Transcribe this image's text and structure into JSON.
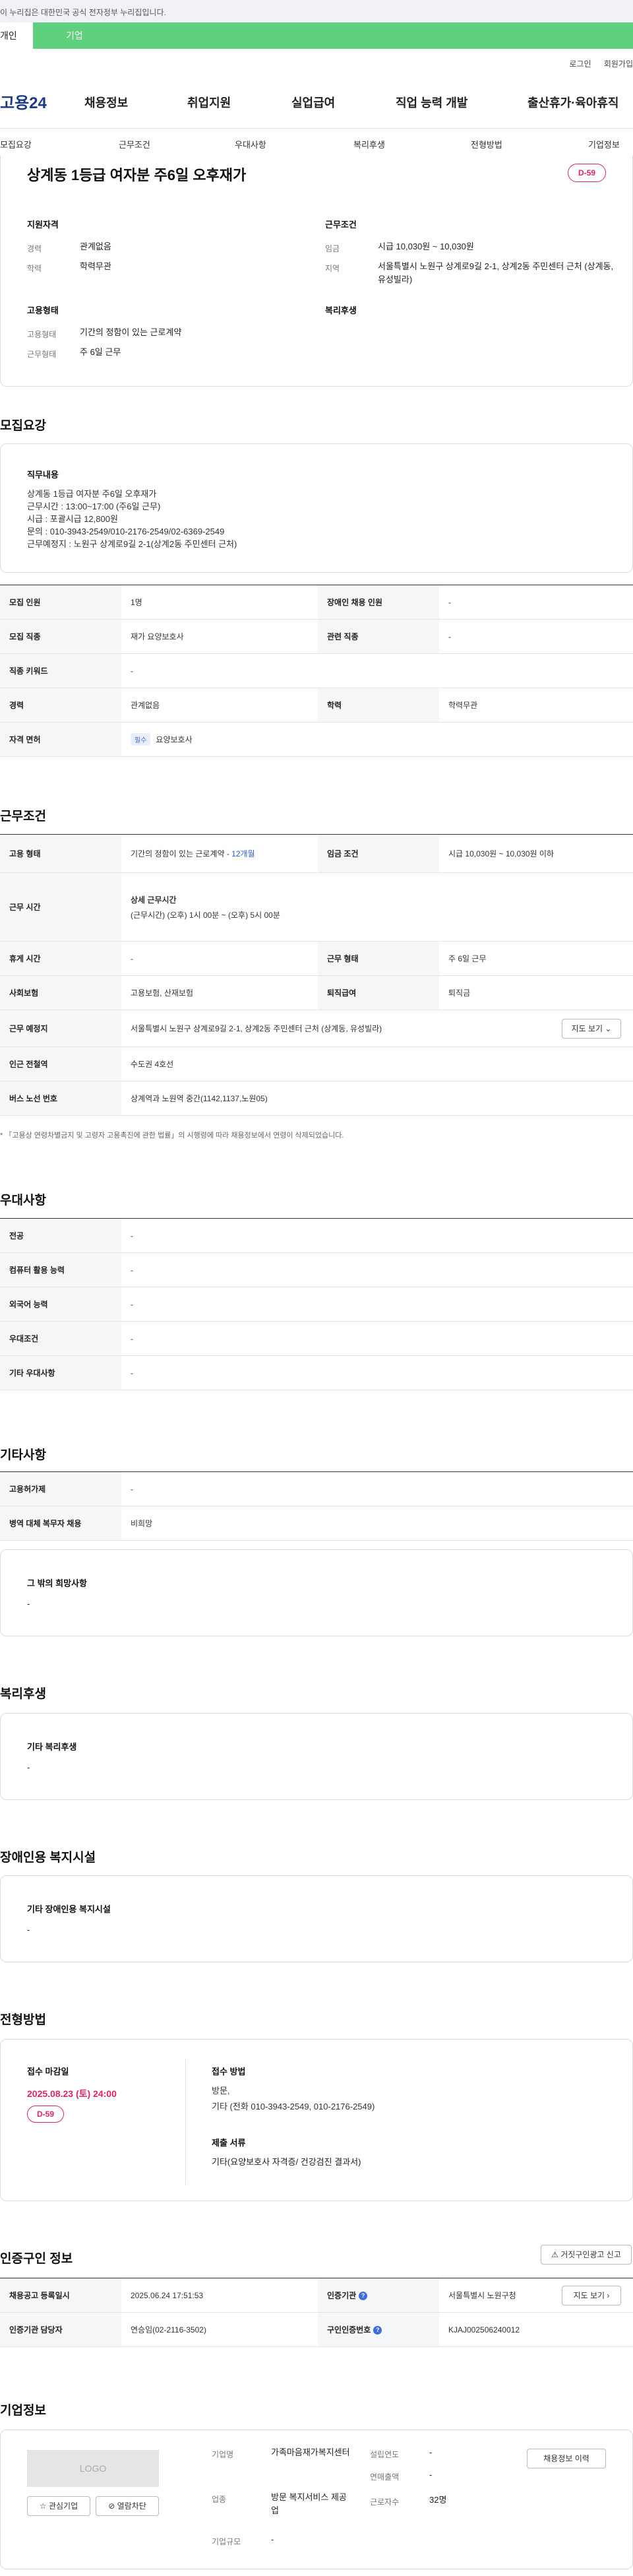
{
  "topbar": {
    "notice": "이 누리집은 대한민국 공식 전자정부 누리집입니다."
  },
  "user_tabs": {
    "person": "개인",
    "company": "기업"
  },
  "util_links": {
    "login": "로그인",
    "join": "회원가입"
  },
  "brand": {
    "logo": "고용24"
  },
  "gnb": [
    "채용정보",
    "취업지원",
    "실업급여",
    "직업 능력 개발",
    "출산휴가·육아휴직"
  ],
  "subnav": [
    "모집요강",
    "근무조건",
    "우대사항",
    "복리후생",
    "전형방법",
    "기업정보"
  ],
  "summary": {
    "title": "상계동 1등급 여자분 주6일 오후재가",
    "dday": "D-59",
    "qualification": {
      "heading": "지원자격",
      "career_label": "경력",
      "career_value": "관계없음",
      "edu_label": "학력",
      "edu_value": "학력무관"
    },
    "conditions": {
      "heading": "근무조건",
      "wage_label": "임금",
      "wage_value": "시급 10,030원 ~ 10,030원",
      "area_label": "지역",
      "area_value": "서울특별시 노원구 상계로9길 2-1, 상계2동 주민센터 근처 (상계동, 유성빌라)"
    },
    "employment": {
      "heading": "고용형태",
      "type_label": "고용형태",
      "type_value": "기간의 정함이 있는 근로계약",
      "shift_label": "근무형태",
      "shift_value": "주 6일 근무"
    },
    "welfare": {
      "heading": "복리후생"
    }
  },
  "recruit": {
    "heading": "모집요강",
    "duty_heading": "직무내용",
    "duty_text": "상계동 1등급 여자분 주6일 오후재가\n근무시간 : 13:00~17:00 (주6일 근무)\n시급 : 포괄시급 12,800원\n문의 : 010-3943-2549/010-2176-2549/02-6369-2549\n근무예정지 : 노원구 상계로9길 2-1(상계2동 주민센터 근처)",
    "rows": {
      "headcount_label": "모집 인원",
      "headcount_value": "1명",
      "disabled_label": "장애인 채용 인원",
      "disabled_value": "-",
      "job_label": "모집 직종",
      "job_value": "재가 요양보호사",
      "related_label": "관련 직종",
      "related_value": "-",
      "keyword_label": "직종 키워드",
      "keyword_value": "-",
      "career_label": "경력",
      "career_value": "관계없음",
      "edu_label": "학력",
      "edu_value": "학력무관",
      "license_label": "자격 면허",
      "license_badge": "필수",
      "license_value": "요양보호사"
    }
  },
  "work": {
    "heading": "근무조건",
    "emp_type_label": "고용 형태",
    "emp_type_value": "기간의 정함이 있는 근로계약 - ",
    "emp_type_period": "12개월",
    "wage_label": "임금 조건",
    "wage_value": "시급 10,030원 ~ 10,030원 이하",
    "hours_label": "근무 시간",
    "hours_sub": "상세 근무시간",
    "hours_value": "(근무시간) (오후) 1시 00분 ~ (오후) 5시 00분",
    "break_label": "휴게 시간",
    "break_value": "-",
    "shift_label": "근무 형태",
    "shift_value": "주 6일 근무",
    "insurance_label": "사회보험",
    "insurance_value": "고용보험, 산재보험",
    "severance_label": "퇴직급여",
    "severance_value": "퇴직금",
    "place_label": "근무 예정지",
    "place_value": "서울특별시 노원구 상계로9길 2-1, 상계2동 주민센터 근처 (상계동, 유성빌라)",
    "map_button": "지도 보기",
    "subway_label": "인근 전철역",
    "subway_value": "수도권 4호선",
    "bus_label": "버스 노선 번호",
    "bus_value": "상계역과 노원역 중간(1142,1137,노원05)",
    "note": "* 「고용상 연령차별금지 및 고령자 고용촉진에 관한 법률」의 시행령에 따라 채용정보에서 연령이 삭제되었습니다."
  },
  "preference": {
    "heading": "우대사항",
    "rows": [
      {
        "label": "전공",
        "value": "-"
      },
      {
        "label": "컴퓨터 활용 능력",
        "value": "-"
      },
      {
        "label": "외국어 능력",
        "value": "-"
      },
      {
        "label": "우대조건",
        "value": "-"
      },
      {
        "label": "기타 우대사항",
        "value": "-"
      }
    ]
  },
  "etc": {
    "heading": "기타사항",
    "rows": [
      {
        "label": "고용허가제",
        "value": "-"
      },
      {
        "label": "병역 대체 복무자 채용",
        "value": "비희망"
      }
    ],
    "other_heading": "그 밖의 희망사항",
    "other_value": "-"
  },
  "benefit": {
    "heading": "복리후생",
    "sub": "기타 복리후생",
    "value": "-"
  },
  "disability": {
    "heading": "장애인용 복지시설",
    "sub": "기타 장애인용 복지시설",
    "value": "-"
  },
  "process": {
    "heading": "전형방법",
    "deadline_label": "접수 마감일",
    "deadline_value": "2025.08.23 (토) 24:00",
    "dday": "D-59",
    "method_label": "접수 방법",
    "method_value": "방문,\n기타 (전화 010-3943-2549, 010-2176-2549)",
    "docs_label": "제출 서류",
    "docs_value": "기타(요양보호사 자격증/ 건강검진 결과서)"
  },
  "cert": {
    "heading": "인증구인 정보",
    "report_button": "거짓구인광고 신고",
    "date_label": "채용공고 등록일시",
    "date_value": "2025.06.24 17:51:53",
    "agency_label": "인증기관",
    "agency_value": "서울특별시 노원구청",
    "map_button": "지도 보기",
    "manager_label": "인증기관 담당자",
    "manager_value": "연승임(02-2116-3502)",
    "number_label": "구인인증번호",
    "number_value": "KJAJ002506240012"
  },
  "company": {
    "heading": "기업정보",
    "logo": "LOGO",
    "fav_button": "관심기업",
    "block_button": "열람차단",
    "name_label": "기업명",
    "name_value": "가족마음재가복지센터",
    "industry_label": "업종",
    "industry_value": "방문 복지서비스 제공업",
    "scale_label": "기업규모",
    "scale_value": "-",
    "founded_label": "설립연도",
    "founded_value": "-",
    "revenue_label": "연매출액",
    "revenue_value": "-",
    "staff_label": "근로자수",
    "staff_value": "32명",
    "history_button": "채용정보 이력"
  }
}
